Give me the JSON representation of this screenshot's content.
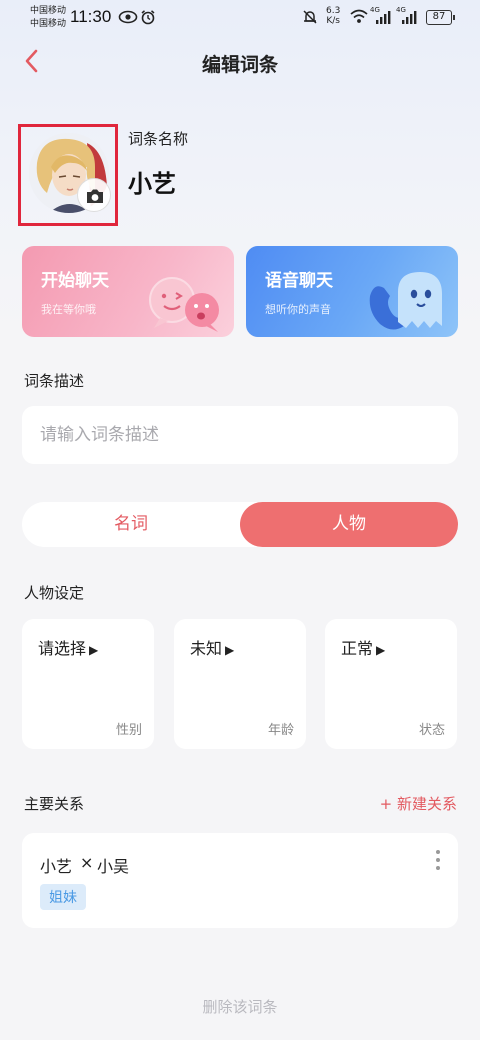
{
  "status_bar": {
    "carrier1": "中国移动",
    "carrier2": "中国移动",
    "time": "11:30",
    "net_speed_value": "6.3",
    "net_speed_unit": "K/s",
    "signal1_label": "4G",
    "signal2_label": "4G",
    "battery": "87"
  },
  "header": {
    "title": "编辑词条"
  },
  "entry": {
    "name_label": "词条名称",
    "name": "小艺"
  },
  "chat_cards": [
    {
      "title": "开始聊天",
      "subtitle": "我在等你哦"
    },
    {
      "title": "语音聊天",
      "subtitle": "想听你的声音"
    }
  ],
  "description": {
    "label": "词条描述",
    "placeholder": "请输入词条描述",
    "value": ""
  },
  "type_segment": {
    "options": [
      "名词",
      "人物"
    ],
    "selected": "人物"
  },
  "character_settings": {
    "label": "人物设定",
    "cards": [
      {
        "value": "请选择",
        "label": "性别"
      },
      {
        "value": "未知",
        "label": "年龄"
      },
      {
        "value": "正常",
        "label": "状态"
      }
    ]
  },
  "relations": {
    "label": "主要关系",
    "new_button": "+ 新建关系",
    "items": [
      {
        "person_a": "小艺",
        "separator": "×",
        "person_b": "小吴",
        "tag": "姐妹"
      }
    ]
  },
  "delete_label": "删除该词条",
  "colors": {
    "accent": "#ee6f70",
    "accent_text": "#e35a61",
    "highlight_frame": "#e0263c",
    "card_pink": "#f49ab1",
    "card_blue": "#4f8cf3",
    "tag_blue": "#4b9ae4"
  }
}
